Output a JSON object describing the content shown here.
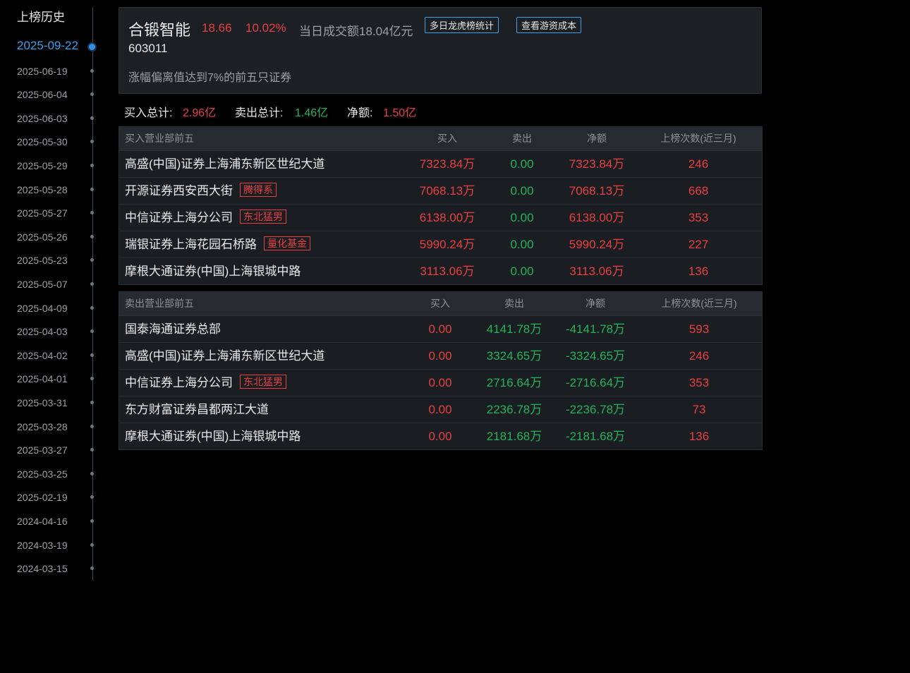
{
  "sidebar": {
    "title": "上榜历史",
    "dates": [
      {
        "label": "2025-09-22",
        "active": true
      },
      {
        "label": "2025-06-19"
      },
      {
        "label": "2025-06-04"
      },
      {
        "label": "2025-06-03"
      },
      {
        "label": "2025-05-30"
      },
      {
        "label": "2025-05-29"
      },
      {
        "label": "2025-05-28"
      },
      {
        "label": "2025-05-27"
      },
      {
        "label": "2025-05-26"
      },
      {
        "label": "2025-05-23"
      },
      {
        "label": "2025-05-07"
      },
      {
        "label": "2025-04-09"
      },
      {
        "label": "2025-04-03"
      },
      {
        "label": "2025-04-02"
      },
      {
        "label": "2025-04-01"
      },
      {
        "label": "2025-03-31"
      },
      {
        "label": "2025-03-28"
      },
      {
        "label": "2025-03-27"
      },
      {
        "label": "2025-03-25"
      },
      {
        "label": "2025-02-19"
      },
      {
        "label": "2024-04-16"
      },
      {
        "label": "2024-03-19"
      },
      {
        "label": "2024-03-15"
      }
    ]
  },
  "header": {
    "name": "合锻智能",
    "price": "18.66",
    "change": "10.02%",
    "turnover": "当日成交额18.04亿元",
    "btn_multi": "多日龙虎榜统计",
    "btn_cost": "查看游资成本",
    "code": "603011",
    "reason": "涨幅偏离值达到7%的前五只证券"
  },
  "summary": {
    "buy_label": "买入总计:",
    "buy_value": "2.96亿",
    "sell_label": "卖出总计:",
    "sell_value": "1.46亿",
    "net_label": "净额:",
    "net_value": "1.50亿"
  },
  "buy_table": {
    "headers": [
      "买入营业部前五",
      "买入",
      "卖出",
      "净额",
      "上榜次数(近三月)"
    ],
    "rows": [
      {
        "name": "高盛(中国)证券上海浦东新区世纪大道",
        "tag": "",
        "buy": "7323.84万",
        "sell": "0.00",
        "net": "7323.84万",
        "count": "246"
      },
      {
        "name": "开源证券西安西大街",
        "tag": "腾得系",
        "buy": "7068.13万",
        "sell": "0.00",
        "net": "7068.13万",
        "count": "668"
      },
      {
        "name": "中信证券上海分公司",
        "tag": "东北猛男",
        "buy": "6138.00万",
        "sell": "0.00",
        "net": "6138.00万",
        "count": "353"
      },
      {
        "name": "瑞银证券上海花园石桥路",
        "tag": "量化基金",
        "buy": "5990.24万",
        "sell": "0.00",
        "net": "5990.24万",
        "count": "227"
      },
      {
        "name": "摩根大通证券(中国)上海银城中路",
        "tag": "",
        "buy": "3113.06万",
        "sell": "0.00",
        "net": "3113.06万",
        "count": "136"
      }
    ]
  },
  "sell_table": {
    "headers": [
      "卖出营业部前五",
      "买入",
      "卖出",
      "净额",
      "上榜次数(近三月)"
    ],
    "rows": [
      {
        "name": "国泰海通证券总部",
        "tag": "",
        "buy": "0.00",
        "sell": "4141.78万",
        "net": "-4141.78万",
        "count": "593"
      },
      {
        "name": "高盛(中国)证券上海浦东新区世纪大道",
        "tag": "",
        "buy": "0.00",
        "sell": "3324.65万",
        "net": "-3324.65万",
        "count": "246"
      },
      {
        "name": "中信证券上海分公司",
        "tag": "东北猛男",
        "buy": "0.00",
        "sell": "2716.64万",
        "net": "-2716.64万",
        "count": "353"
      },
      {
        "name": "东方财富证券昌都两江大道",
        "tag": "",
        "buy": "0.00",
        "sell": "2236.78万",
        "net": "-2236.78万",
        "count": "73"
      },
      {
        "name": "摩根大通证券(中国)上海银城中路",
        "tag": "",
        "buy": "0.00",
        "sell": "2181.68万",
        "net": "-2181.68万",
        "count": "136"
      }
    ]
  },
  "colors": {
    "up": "#e84040",
    "down": "#25b35a",
    "accent": "#3d9fe8",
    "background": "#000000"
  }
}
